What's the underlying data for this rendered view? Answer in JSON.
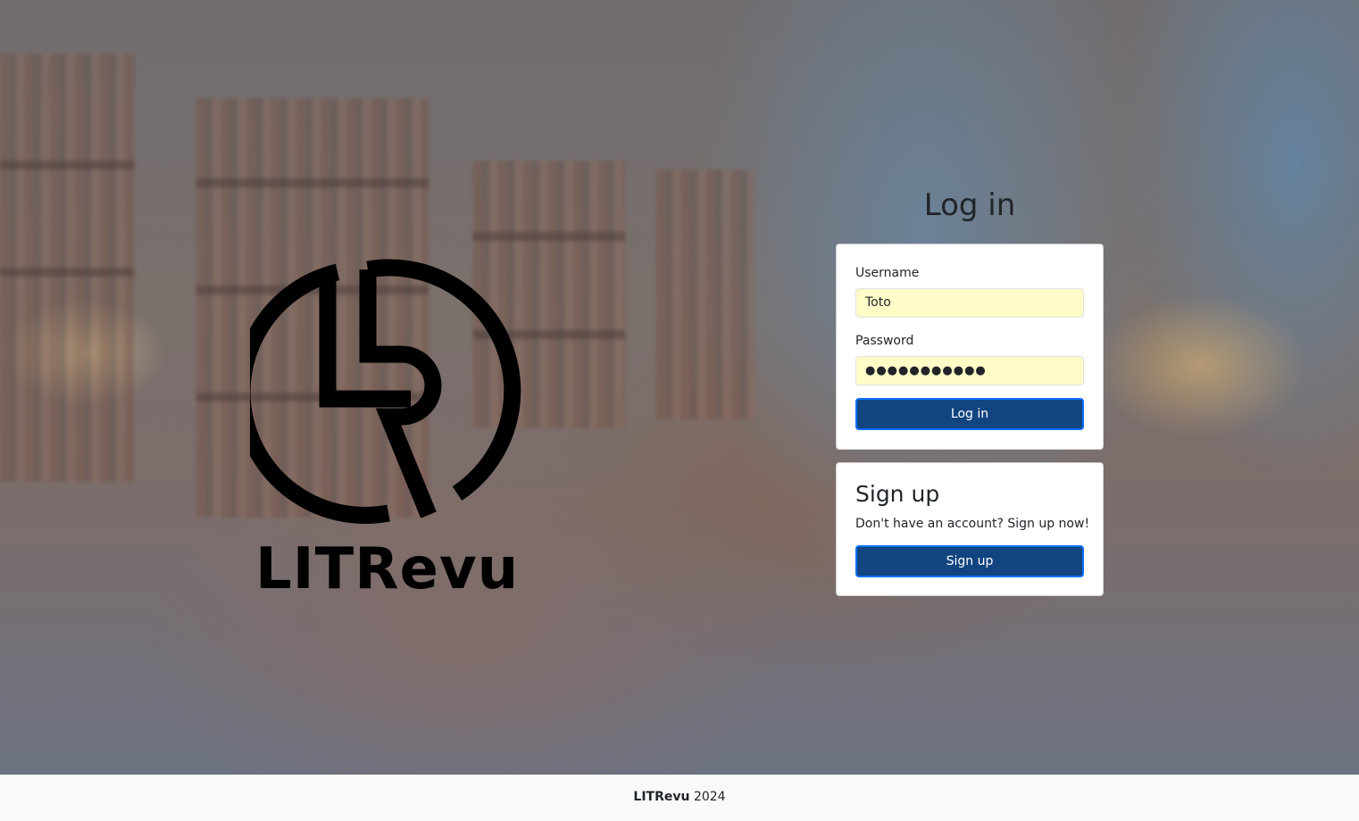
{
  "brand": {
    "logo_text": "LITRevu"
  },
  "login": {
    "title": "Log in",
    "username_label": "Username",
    "username_value": "Toto",
    "password_label": "Password",
    "password_value": "●●●●●●●●●●●",
    "submit_label": "Log in"
  },
  "signup": {
    "title": "Sign up",
    "text": "Don't have an account? Sign up now!",
    "button_label": "Sign up"
  },
  "footer": {
    "brand": "LITRevu",
    "year": "2024"
  },
  "colors": {
    "button_bg": "#124480",
    "button_border": "#0d6efd",
    "input_autofill_bg": "#fffcc8",
    "footer_bg": "#f8f9fa"
  }
}
